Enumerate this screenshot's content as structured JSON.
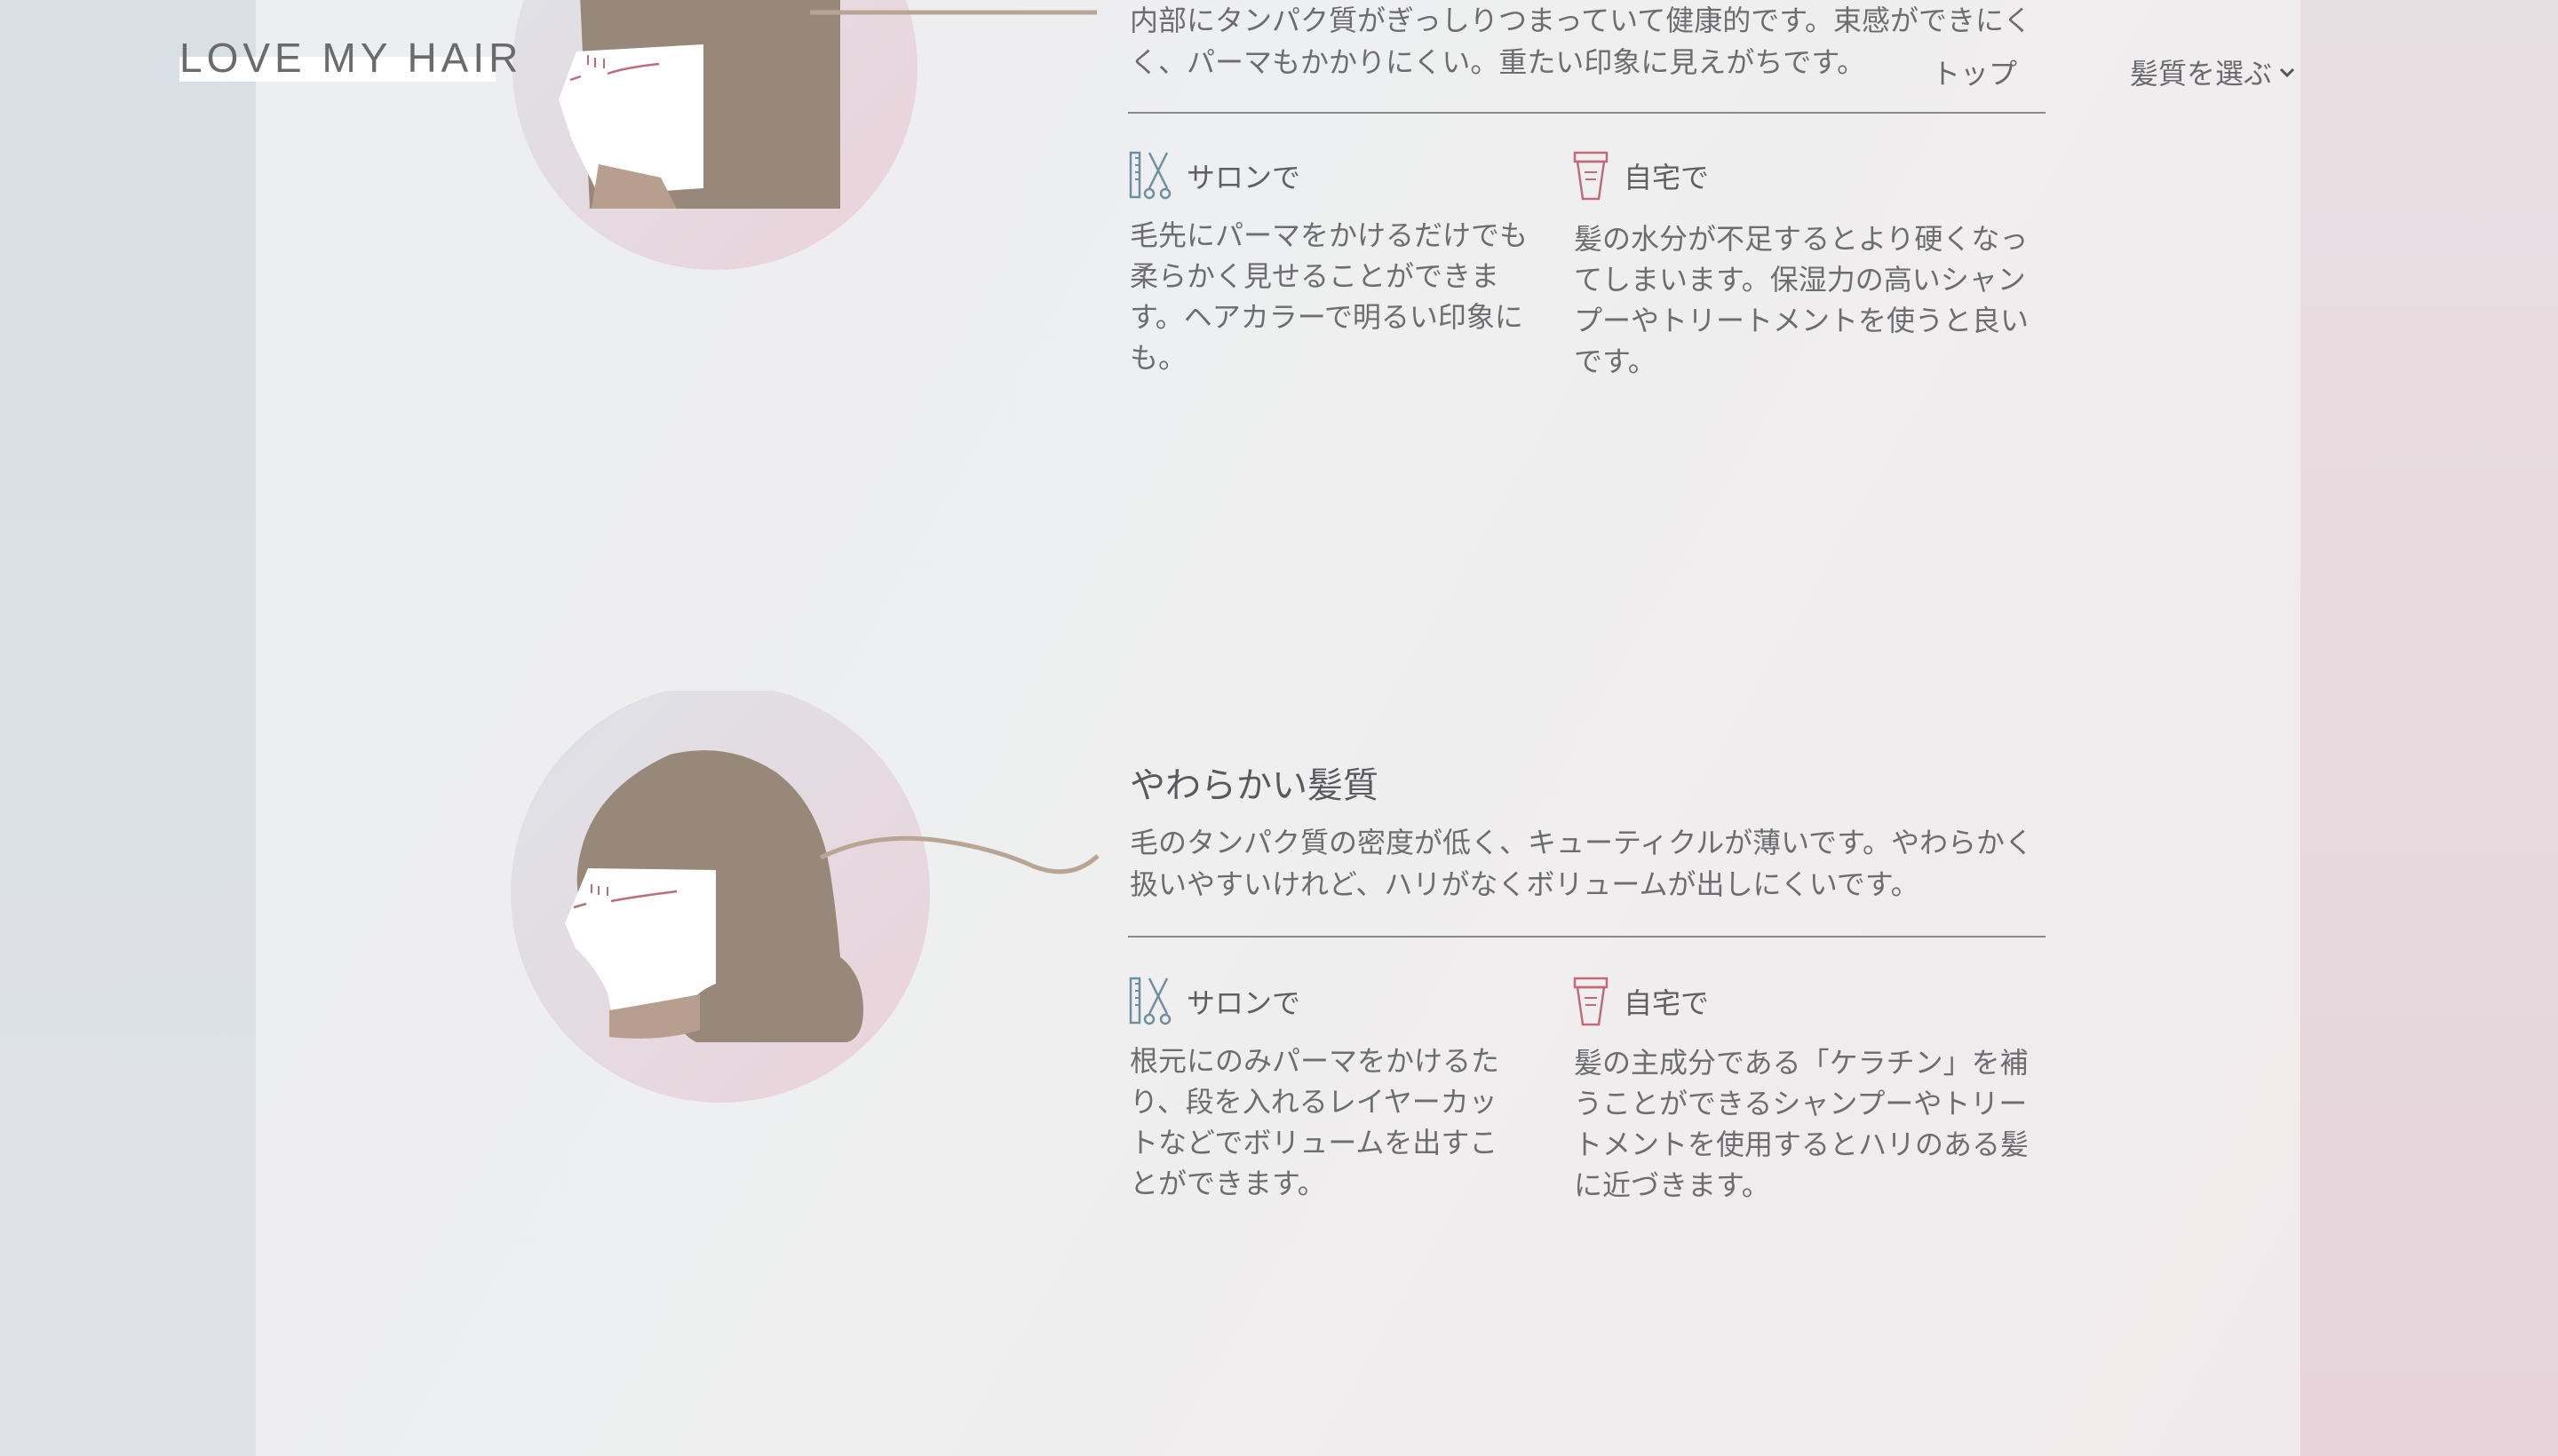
{
  "header": {
    "logo": "LOVE MY HAIR",
    "nav": {
      "top": "トップ",
      "select": "髪質を選ぶ"
    }
  },
  "sections": [
    {
      "description_line1": "内部にタンパク質がぎっしりつまっていて健康的です。束感ができにく",
      "description_line2": "く、パーマもかかりにくい。重たい印象に見えがちです。",
      "salon": {
        "label": "サロンで",
        "text": [
          "毛先にパーマをかけるだけでも",
          "柔らかく見せることができま",
          "す。ヘアカラーで明るい印象に",
          "も。"
        ]
      },
      "home": {
        "label": "自宅で",
        "text": [
          "髪の水分が不足するとより硬くなっ",
          "てしまいます。保湿力の高いシャン",
          "プーやトリートメントを使うと良い",
          "です。"
        ]
      }
    },
    {
      "title": "やわらかい髪質",
      "description_line1": "毛のタンパク質の密度が低く、キューティクルが薄いです。やわらかく",
      "description_line2": "扱いやすいけれど、ハリがなくボリュームが出しにくいです。",
      "salon": {
        "label": "サロンで",
        "text": [
          "根元にのみパーマをかけるた",
          "り、段を入れるレイヤーカッ",
          "トなどでボリュームを出すこ",
          "とができます。"
        ]
      },
      "home": {
        "label": "自宅で",
        "text": [
          "髪の主成分である「ケラチン」を補",
          "うことができるシャンプーやトリー",
          "トメントを使用するとハリのある髪",
          "に近づきます。"
        ]
      }
    }
  ],
  "icons": {
    "salon": "scissors-comb-icon",
    "home": "shampoo-bottle-icon",
    "nav": "chevron-down-icon"
  },
  "colors": {
    "hair": "#978879",
    "skin": "#ffffff",
    "lash": "#c06b7a",
    "rule": "#8a8a8e",
    "wave": "#b9a594"
  }
}
